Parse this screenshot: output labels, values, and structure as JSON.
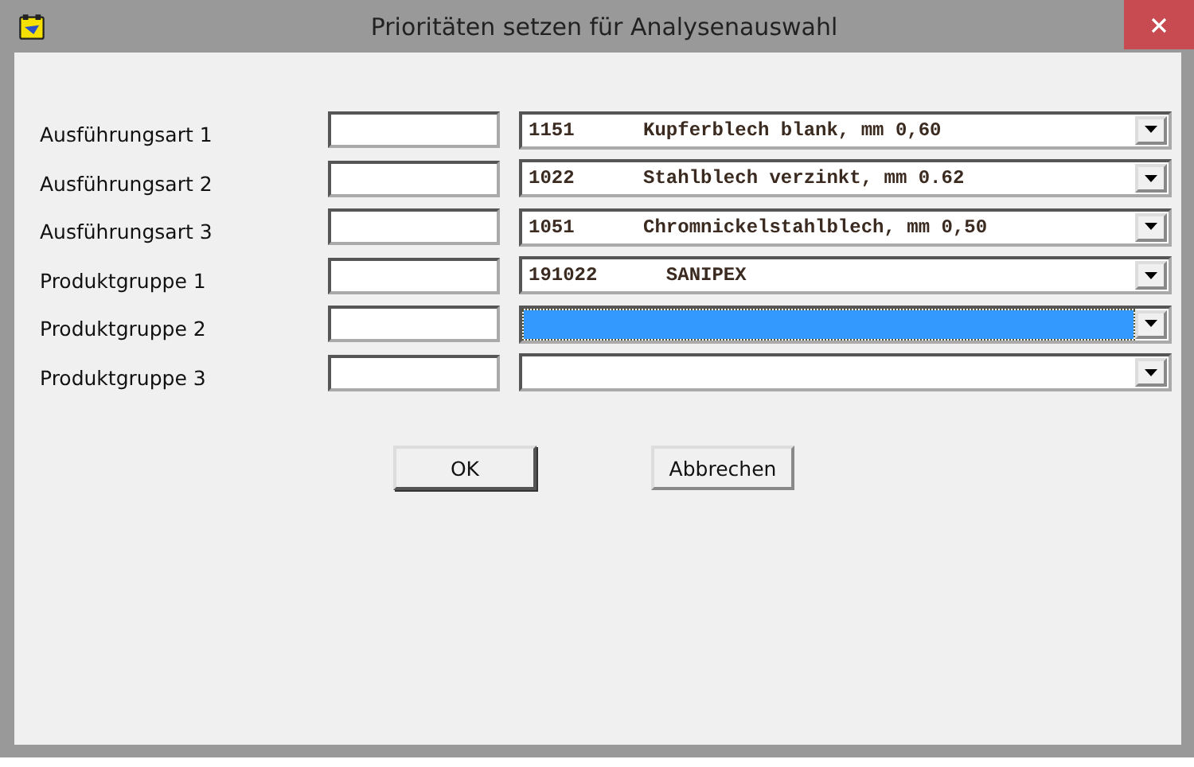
{
  "window": {
    "title": "Prioritäten setzen für Analysenauswahl"
  },
  "rows": [
    {
      "label": "Ausführungsart 1",
      "combo": {
        "value": "1151      Kupferblech blank, mm 0,60",
        "focused": false
      }
    },
    {
      "label": "Ausführungsart 2",
      "combo": {
        "value": "1022      Stahlblech verzinkt, mm 0.62",
        "focused": false
      }
    },
    {
      "label": "Ausführungsart 3",
      "combo": {
        "value": "1051      Chromnickelstahlblech, mm 0,50",
        "focused": false
      }
    },
    {
      "label": "Produktgruppe 1",
      "combo": {
        "value": "191022      SANIPEX",
        "focused": false
      }
    },
    {
      "label": "Produktgruppe 2",
      "combo": {
        "focused": true
      }
    },
    {
      "label": "Produktgruppe 3",
      "combo": {
        "focused": false
      }
    }
  ],
  "buttons": [
    {
      "label": "OK",
      "default": true
    },
    {
      "label": "Abbrechen",
      "default": false
    }
  ]
}
